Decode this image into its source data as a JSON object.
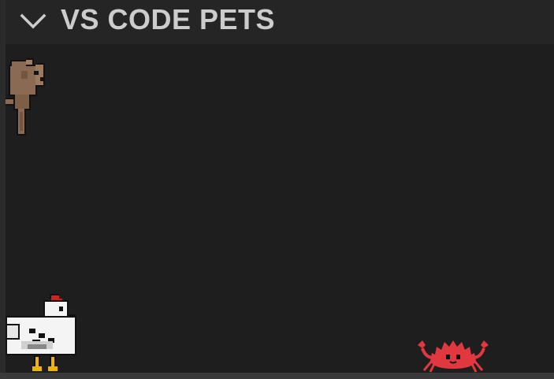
{
  "panel": {
    "title": "VS CODE PETS",
    "expanded": true
  },
  "icons": {
    "collapse": "chevron-down-icon"
  },
  "pets": [
    {
      "type": "dog",
      "color": "brown",
      "state": "climbing wall"
    },
    {
      "type": "chicken",
      "color": "white",
      "state": "idle"
    },
    {
      "type": "crab",
      "color": "red",
      "state": "walking"
    }
  ],
  "colors": {
    "background": "#1e1e1e",
    "header": "#252526",
    "title": "#cccccc",
    "floor": "#3a3a3a",
    "crab": "#e0383e",
    "chicken_comb": "#d42020",
    "chicken_beak": "#f0b400",
    "dog": "#8a6a52"
  }
}
